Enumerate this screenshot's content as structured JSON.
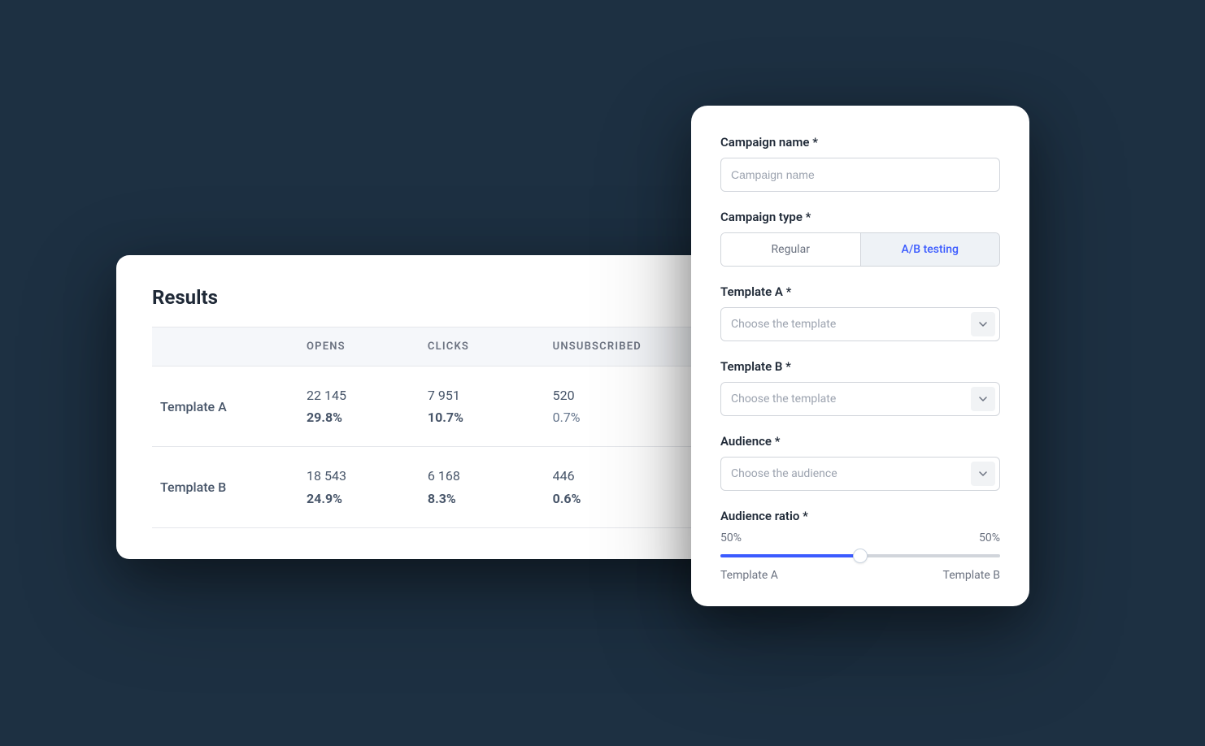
{
  "results": {
    "title": "Results",
    "columns": {
      "opens": "OPENS",
      "clicks": "CLICKS",
      "unsub": "UNSUBSCRIBED"
    },
    "rows": [
      {
        "label": "Template A",
        "opens_n": "22 145",
        "opens_pct": "29.8%",
        "clicks_n": "7 951",
        "clicks_pct": "10.7%",
        "unsub_n": "520",
        "unsub_pct": "0.7%",
        "unsub_bold": false
      },
      {
        "label": "Template B",
        "opens_n": "18 543",
        "opens_pct": "24.9%",
        "clicks_n": "6 168",
        "clicks_pct": "8.3%",
        "unsub_n": "446",
        "unsub_pct": "0.6%",
        "unsub_bold": true
      }
    ]
  },
  "form": {
    "campaign_name": {
      "label": "Campaign name *",
      "placeholder": "Campaign name"
    },
    "campaign_type": {
      "label": "Campaign type *",
      "option_regular": "Regular",
      "option_ab": "A/B testing"
    },
    "template_a": {
      "label": "Template A *",
      "placeholder": "Choose the template"
    },
    "template_b": {
      "label": "Template B *",
      "placeholder": "Choose the template"
    },
    "audience": {
      "label": "Audience *",
      "placeholder": "Choose the audience"
    },
    "ratio": {
      "label": "Audience ratio *",
      "left_pct": "50%",
      "right_pct": "50%",
      "left_label": "Template A",
      "right_label": "Template B"
    }
  }
}
